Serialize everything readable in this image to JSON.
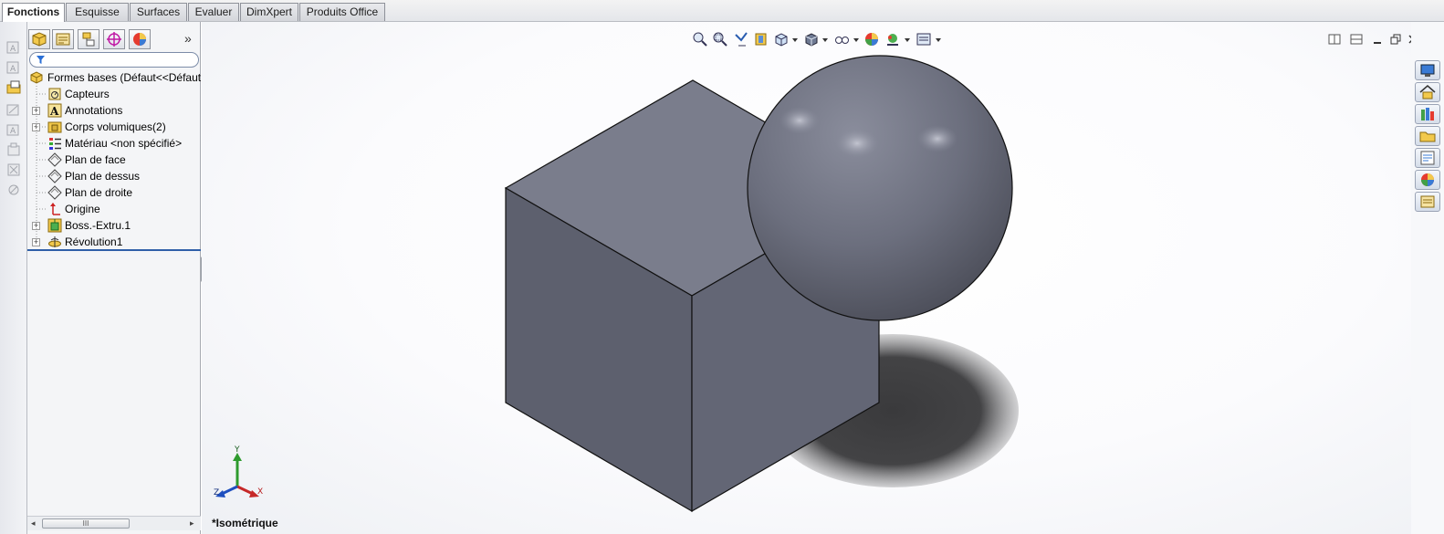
{
  "tabs": [
    "Fonctions",
    "Esquisse",
    "Surfaces",
    "Evaluer",
    "DimXpert",
    "Produits Office"
  ],
  "active_tab": "Fonctions",
  "feature_manager": {
    "collapse_label": "»",
    "root": "Formes bases  (Défaut<<Défaut",
    "items": [
      {
        "label": "Capteurs",
        "icon": "sensor-icon",
        "expandable": false
      },
      {
        "label": "Annotations",
        "icon": "annotation-icon",
        "expandable": true
      },
      {
        "label": "Corps volumiques(2)",
        "icon": "solid-bodies-icon",
        "expandable": true
      },
      {
        "label": "Matériau <non spécifié>",
        "icon": "material-icon",
        "expandable": false
      },
      {
        "label": "Plan de face",
        "icon": "plane-icon",
        "expandable": false
      },
      {
        "label": "Plan de dessus",
        "icon": "plane-icon",
        "expandable": false
      },
      {
        "label": "Plan de droite",
        "icon": "plane-icon",
        "expandable": false
      },
      {
        "label": "Origine",
        "icon": "origin-icon",
        "expandable": false
      },
      {
        "label": "Boss.-Extru.1",
        "icon": "extrude-icon",
        "expandable": true
      },
      {
        "label": "Révolution1",
        "icon": "revolve-icon",
        "expandable": true
      }
    ],
    "scroll_thumb": "III"
  },
  "triad": {
    "y": "Y",
    "x": "X",
    "z": "Z"
  },
  "view_name": "*Isométrique",
  "colors": {
    "model": "#6f7282",
    "shadow": "#3c3c3e",
    "accent": "#2f5fa8"
  }
}
